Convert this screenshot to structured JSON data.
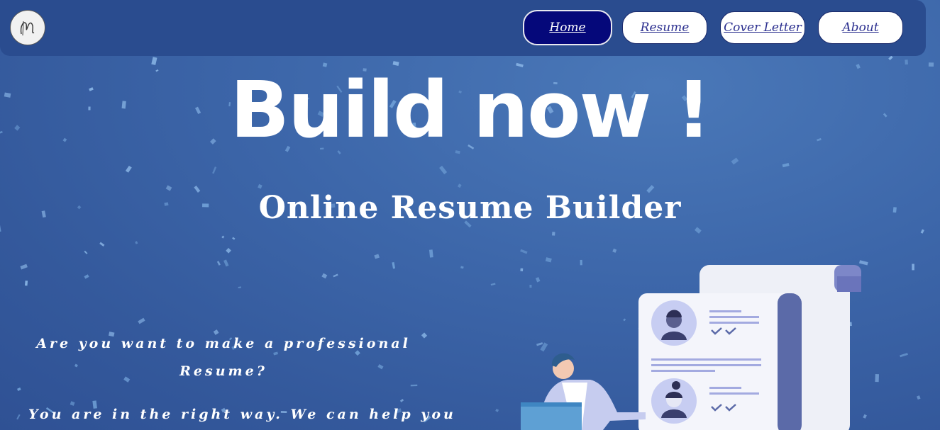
{
  "nav": {
    "logo_name": "logo-icon",
    "items": [
      {
        "label": "Home",
        "active": true
      },
      {
        "label": "Resume",
        "active": false
      },
      {
        "label": "Cover Letter",
        "active": false
      },
      {
        "label": "About",
        "active": false
      }
    ]
  },
  "hero": {
    "title": "Build now !",
    "subtitle": "Online Resume Builder"
  },
  "intro": {
    "question": "Are you want to make a professional Resume?",
    "answer": "You are in the right way. We can help you"
  },
  "colors": {
    "background": "#3d67aa",
    "navbar": "#2a4c8f",
    "active_button": "#05087a",
    "link_text": "#2b2f8f"
  }
}
